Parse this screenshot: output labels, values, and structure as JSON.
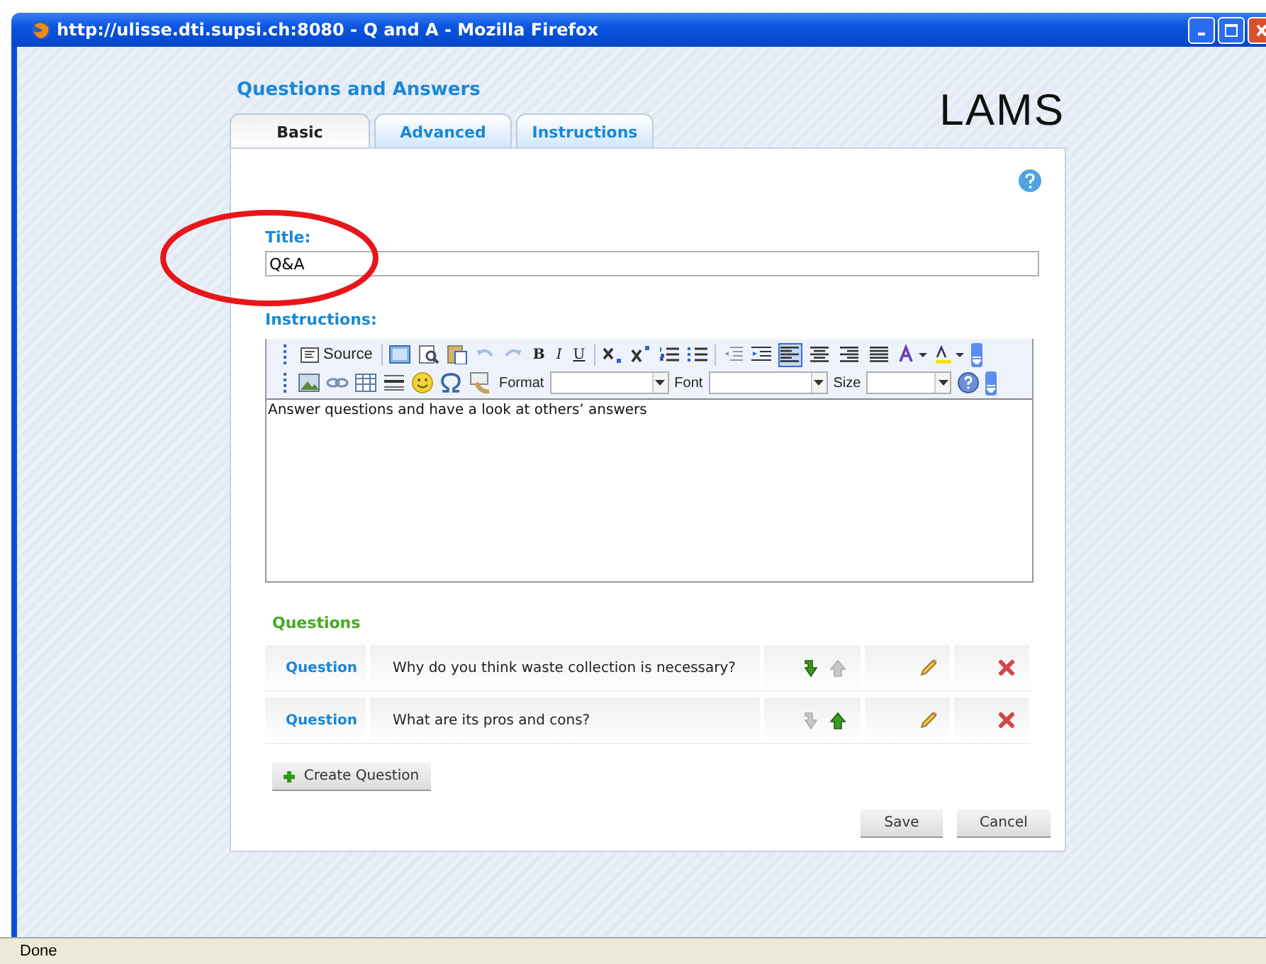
{
  "window": {
    "title": "http://ulisse.dti.supsi.ch:8080 - Q and A - Mozilla Firefox"
  },
  "page": {
    "heading": "Questions and Answers",
    "logo": "LAMS"
  },
  "tabs": [
    {
      "label": "Basic",
      "selected": true
    },
    {
      "label": "Advanced",
      "selected": false
    },
    {
      "label": "Instructions",
      "selected": false
    }
  ],
  "title_field": {
    "label": "Title:",
    "value": "Q&A"
  },
  "instructions": {
    "label": "Instructions:",
    "value": "Answer questions and have a look at others’ answers"
  },
  "toolbar": {
    "source": "Source",
    "bold": "B",
    "italic": "I",
    "underline": "U",
    "format_label": "Format",
    "font_label": "Font",
    "size_label": "Size",
    "alignments": [
      {
        "selected": true
      },
      {
        "selected": false
      },
      {
        "selected": false
      },
      {
        "selected": false
      }
    ]
  },
  "questions": {
    "label": "Questions",
    "rows": [
      {
        "type": "Question",
        "text": "Why do you think waste collection is necessary?",
        "down_enabled": true,
        "up_enabled": false
      },
      {
        "type": "Question",
        "text": "What are its pros and cons?",
        "down_enabled": false,
        "up_enabled": true
      }
    ]
  },
  "create_button": "Create Question",
  "buttons": [
    "Save",
    "Cancel"
  ],
  "status_bar": "Done"
}
